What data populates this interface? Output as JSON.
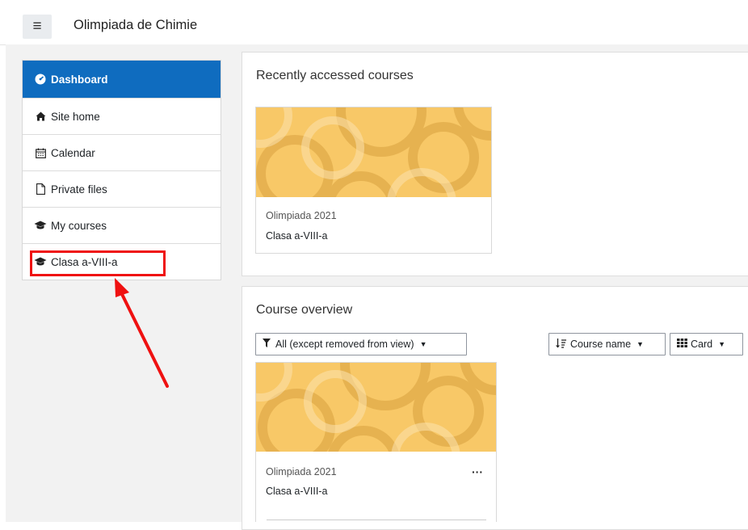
{
  "header": {
    "site_title": "Olimpiada de Chimie",
    "menu_icon": "hamburger-icon"
  },
  "nav": {
    "items": [
      {
        "label": "Dashboard",
        "icon": "dashboard-icon",
        "active": true
      },
      {
        "label": "Site home",
        "icon": "home-icon"
      },
      {
        "label": "Calendar",
        "icon": "calendar-icon"
      },
      {
        "label": "Private files",
        "icon": "file-icon"
      },
      {
        "label": "My courses",
        "icon": "graduation-cap-icon"
      },
      {
        "label": "Clasa a-VIII-a",
        "icon": "graduation-cap-icon"
      }
    ]
  },
  "recent": {
    "title": "Recently accessed courses",
    "course": {
      "category": "Olimpiada 2021",
      "name": "Clasa a-VIII-a"
    }
  },
  "overview": {
    "title": "Course overview",
    "filter_label": "All (except removed from view)",
    "sort_label": "Course name",
    "view_label": "Card",
    "course": {
      "category": "Olimpiada 2021",
      "name": "Clasa a-VIII-a",
      "menu": "···"
    }
  },
  "colors": {
    "accent": "#0f6cbf",
    "highlight": "#ef1111",
    "course_image": "#f8c867"
  }
}
